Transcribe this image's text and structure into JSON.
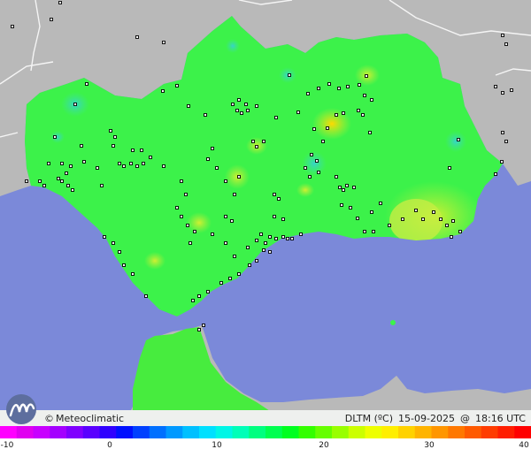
{
  "map": {
    "brand": "Meteoclimatic",
    "copyright_symbol": "©",
    "variable": "DLTM (ºC)",
    "date": "15-09-2025",
    "at_symbol": "@",
    "time": "18:16 UTC"
  },
  "colors": {
    "sea": "#7b89d9",
    "land_outside": "#b9b9b9",
    "land_main": "#3cf24a",
    "warm_patch": "#c6ee44",
    "cool_patch": "#3ad7c0",
    "station_marker": "#000000"
  },
  "legend": {
    "unit": "ºC",
    "min": -10,
    "max": 40,
    "ticks": [
      "-10",
      "0",
      "10",
      "20",
      "30",
      "40"
    ],
    "colors": [
      "#ff00ff",
      "#e000f0",
      "#c800ff",
      "#a400ff",
      "#8000ff",
      "#5a00ff",
      "#3000ff",
      "#0010ff",
      "#0040ff",
      "#0070ff",
      "#0099ff",
      "#00c0ff",
      "#00e0ff",
      "#00f6e6",
      "#00ffb8",
      "#00ff80",
      "#00ff50",
      "#00ff20",
      "#33ff00",
      "#66ff00",
      "#99ff00",
      "#ccff00",
      "#eeff00",
      "#ffee00",
      "#ffd200",
      "#ffb400",
      "#ff9600",
      "#ff7800",
      "#ff5a00",
      "#ff3c00",
      "#ff1e00",
      "#ff0000"
    ]
  }
}
